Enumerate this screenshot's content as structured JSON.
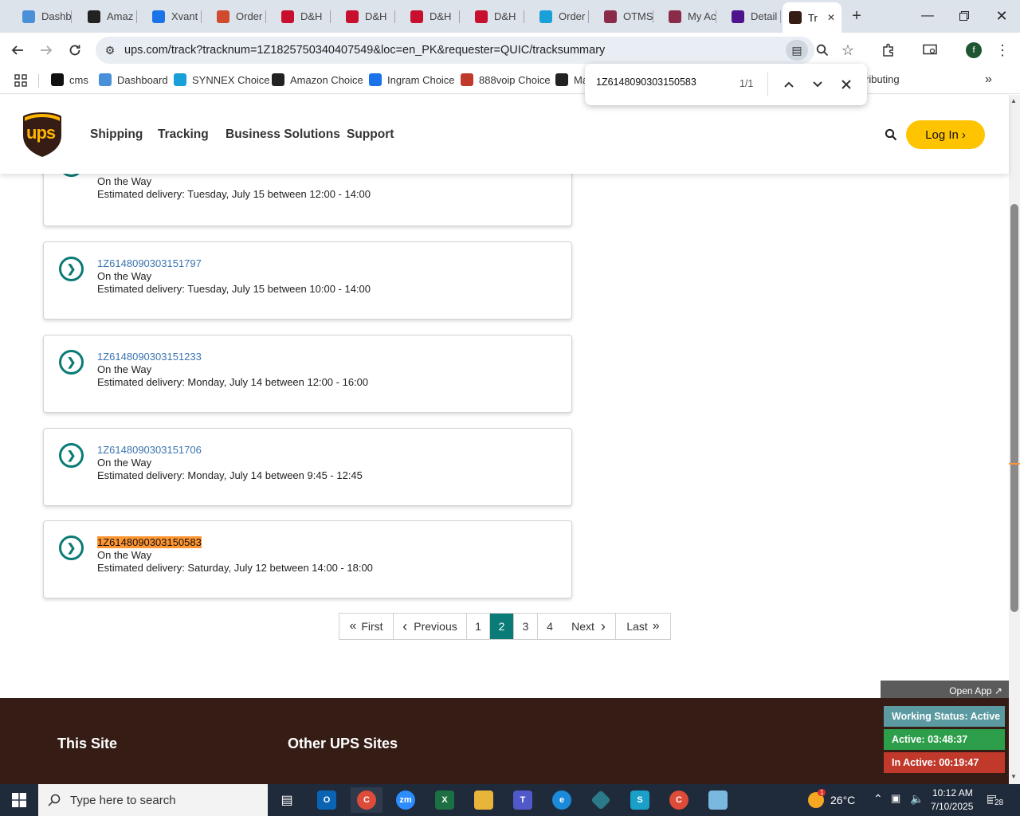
{
  "browser": {
    "tabs": [
      {
        "label": "Dashb",
        "fav_color": "#4a90d9",
        "icon": "globe-icon"
      },
      {
        "label": "Amaz",
        "fav_color": "#222222",
        "icon": "amazon-icon"
      },
      {
        "label": "Xvant",
        "fav_color": "#1a73e8",
        "icon": "xvant-icon"
      },
      {
        "label": "Order",
        "fav_color": "#d04a2e",
        "icon": "order-icon"
      },
      {
        "label": "D&H",
        "fav_color": "#c8102e",
        "icon": "dh-icon"
      },
      {
        "label": "D&H",
        "fav_color": "#c8102e",
        "icon": "dh-icon"
      },
      {
        "label": "D&H",
        "fav_color": "#c8102e",
        "icon": "dh-icon"
      },
      {
        "label": "D&H",
        "fav_color": "#c8102e",
        "icon": "dh-icon"
      },
      {
        "label": "Order",
        "fav_color": "#1aa0d8",
        "icon": "ec-icon"
      },
      {
        "label": "OTMS",
        "fav_color": "#8a2b4a",
        "icon": "otms-icon"
      },
      {
        "label": "My Ac",
        "fav_color": "#8a2b4a",
        "icon": "account-icon"
      },
      {
        "label": "Detail",
        "fav_color": "#4d148c",
        "icon": "fedex-icon"
      },
      {
        "label": "Tr",
        "fav_color": "#351c15",
        "icon": "ups-icon"
      }
    ],
    "url": "ups.com/track?tracknum=1Z1825750340407549&loc=en_PK&requester=QUIC/tracksummary",
    "avatar_letter": "f",
    "bookmarks": [
      {
        "label": "cms",
        "color": "#111111",
        "icon": "cms-icon"
      },
      {
        "label": "Dashboard",
        "color": "#4a90d9",
        "icon": "dashboard-icon"
      },
      {
        "label": "SYNNEX Choice",
        "color": "#1aa0d8",
        "icon": "ec-icon"
      },
      {
        "label": "Amazon Choice",
        "color": "#222222",
        "icon": "amazon-icon"
      },
      {
        "label": "Ingram Choice",
        "color": "#1a73e8",
        "icon": "ingram-icon"
      },
      {
        "label": "888voip Choice",
        "color": "#c0392b",
        "icon": "voip-icon"
      },
      {
        "label": "Ma",
        "color": "#222222",
        "icon": "amazon-icon"
      },
      {
        "label": "ributing",
        "color": "#ffffff",
        "icon": ""
      }
    ]
  },
  "find": {
    "query": "1Z6148090303150583",
    "count": "1/1"
  },
  "ups": {
    "nav": [
      "Shipping",
      "Tracking",
      "Business Solutions",
      "Support"
    ],
    "login_label": "Log In",
    "logo_text": "ups"
  },
  "shipments": [
    {
      "tracking": "",
      "status": "On the Way",
      "estimate": "Estimated delivery: Tuesday, July 15 between 12:00 - 14:00"
    },
    {
      "tracking": "1Z6148090303151797",
      "status": "On the Way",
      "estimate": "Estimated delivery: Tuesday, July 15 between 10:00 - 14:00"
    },
    {
      "tracking": "1Z6148090303151233",
      "status": "On the Way",
      "estimate": "Estimated delivery: Monday, July 14 between 12:00 - 16:00"
    },
    {
      "tracking": "1Z6148090303151706",
      "status": "On the Way",
      "estimate": "Estimated delivery: Monday, July 14 between 9:45 - 12:45"
    },
    {
      "tracking": "1Z6148090303150583",
      "status": "On the Way",
      "estimate": "Estimated delivery: Saturday, July 12 between 14:00 - 18:00"
    }
  ],
  "pagination": {
    "first": "First",
    "previous": "Previous",
    "pages": [
      "1",
      "2",
      "3",
      "4"
    ],
    "current": "2",
    "next": "Next",
    "last": "Last"
  },
  "footer": {
    "col1": "This Site",
    "col2": "Other UPS Sites"
  },
  "widget": {
    "open_app": "Open App ↗",
    "working_status": "Working Status: Active",
    "active": "Active: 03:48:37",
    "inactive": "In Active: 00:19:47",
    "colors": {
      "working": "#5a9aa0",
      "active": "#2d9e4a",
      "inactive": "#c0392b"
    }
  },
  "taskbar": {
    "search_placeholder": "Type here to search",
    "temperature": "26°C",
    "time": "10:12 AM",
    "date": "7/10/2025",
    "notifications": "28",
    "weather_badge": "1"
  }
}
